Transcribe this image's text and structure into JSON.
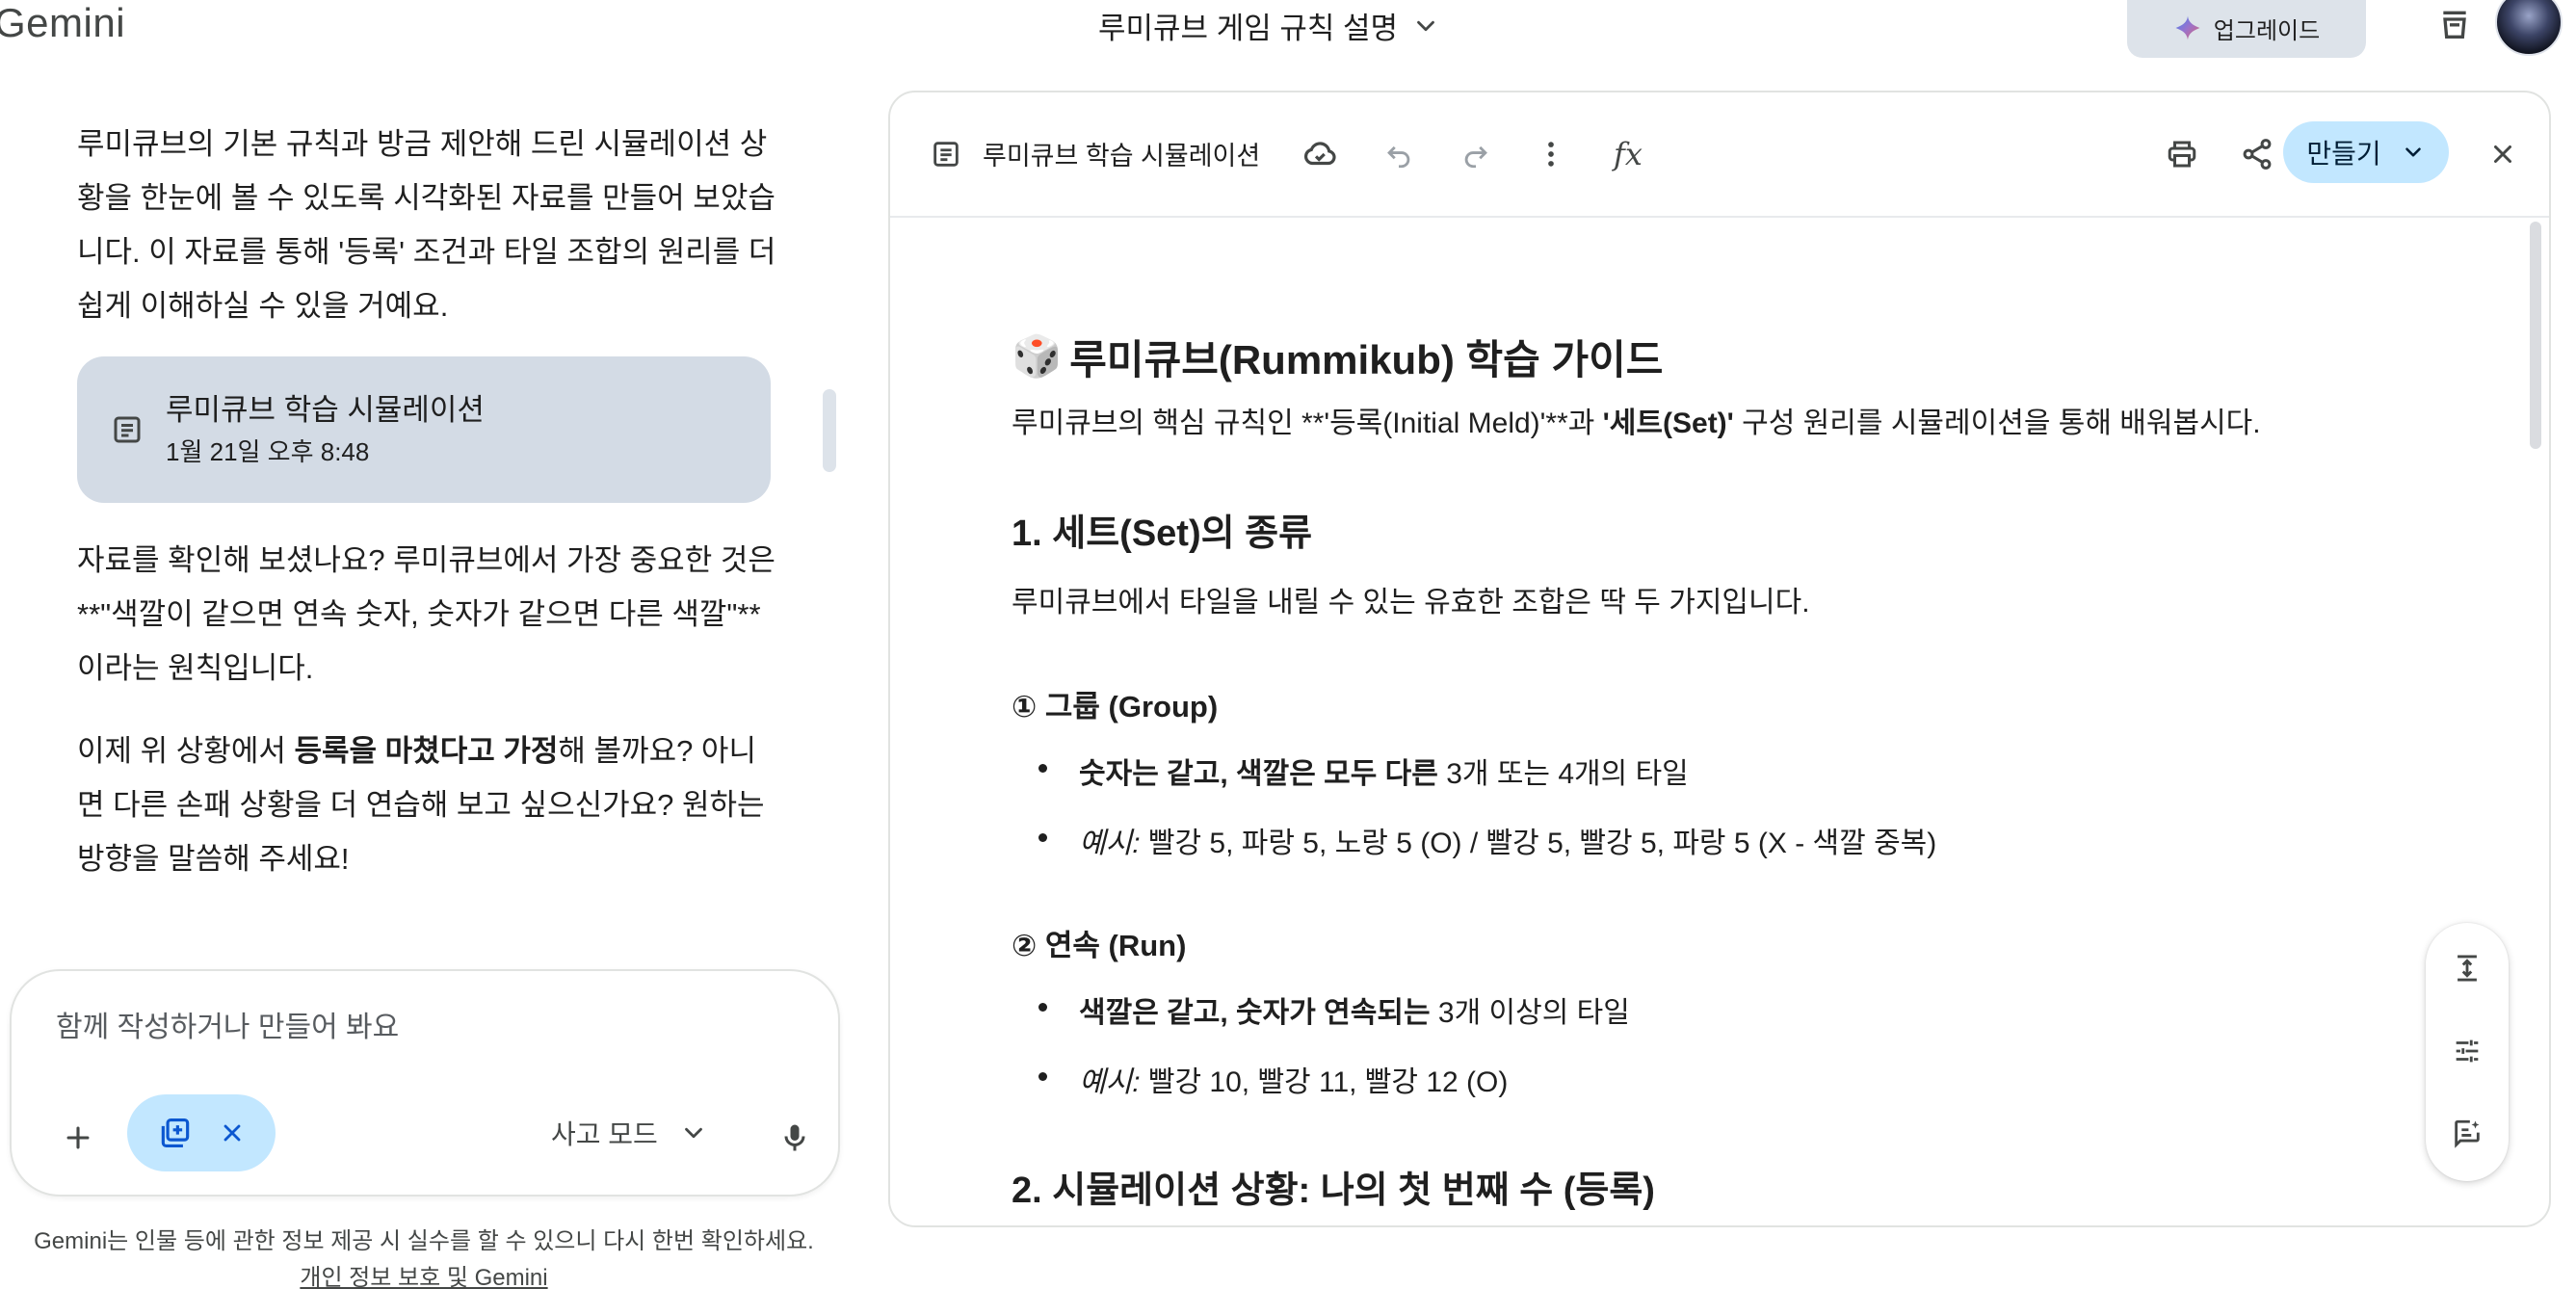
{
  "header": {
    "brand": "Gemini",
    "chat_title": "루미큐브 게임 규칙 설명",
    "upgrade_label": "업그레이드"
  },
  "chat": {
    "intro_text": "루미큐브의 기본 규칙과 방금 제안해 드린 시뮬레이션 상황을 한눈에 볼 수 있도록 시각화된 자료를 만들어 보았습니다. 이 자료를 통해 '등록' 조건과 타일 조합의 원리를 더 쉽게 이해하실 수 있을 거예요.",
    "doc_chip": {
      "title": "루미큐브 학습 시뮬레이션",
      "time": "1월 21일 오후 8:48"
    },
    "followup_text": "자료를 확인해 보셨나요? 루미큐브에서 가장 중요한 것은 **\"색깔이 같으면 연속 숫자, 숫자가 같으면 다른 색깔\"** 이라는 원칙입니다.",
    "closing": {
      "before": "이제 위 상황에서 ",
      "bold": "등록을 마쳤다고 가정",
      "after": "해 볼까요? 아니면 다른 손패 상황을 더 연습해 보고 싶으신가요? 원하는 방향을 말씀해 주세요!"
    }
  },
  "composer": {
    "placeholder": "함께 작성하거나 만들어 봐요",
    "mode_label": "사고 모드"
  },
  "footer": {
    "disclaimer": "Gemini는 인물 등에 관한 정보 제공 시 실수를 할 수 있으니 다시 한번 확인하세요.",
    "privacy_link": "개인 정보 보호 및 Gemini"
  },
  "canvas": {
    "toolbar_title": "루미큐브 학습 시뮬레이션",
    "make_label": "만들기",
    "doc": {
      "title_emoji": "🎲",
      "title": "루미큐브(Rummikub) 학습 가이드",
      "intro": {
        "before": "루미큐브의 핵심 규칙인 **'등록(Initial Meld)'**과 ",
        "bold": "'세트(Set)'",
        "after": " 구성 원리를 시뮬레이션을 통해 배워봅시다."
      },
      "section1_title": "1. 세트(Set)의 종류",
      "section1_text": "루미큐브에서 타일을 내릴 수 있는 유효한 조합은 딱 두 가지입니다.",
      "group": {
        "title": "① 그룹 (Group)",
        "rule_bold": "숫자는 같고, 색깔은 모두 다른",
        "rule_rest": " 3개 또는 4개의 타일",
        "example_label": "예시:",
        "example_text": " 빨강 5, 파랑 5, 노랑 5 (O) / 빨강 5, 빨강 5, 파랑 5 (X - 색깔 중복)"
      },
      "run": {
        "title": "② 연속 (Run)",
        "rule_bold": "색깔은 같고, 숫자가 연속되는",
        "rule_rest": " 3개 이상의 타일",
        "example_label": "예시:",
        "example_text": " 빨강 10, 빨강 11, 빨강 12 (O)"
      },
      "section2_title": "2. 시뮬레이션 상황: 나의 첫 번째 수 (등록)"
    }
  },
  "colors": {
    "chip_bg": "#d3dbe5",
    "accent_blue": "#c2e7ff",
    "upgrade_bg": "#dde3ea",
    "text": "#1f1f1f",
    "muted": "#444746"
  }
}
